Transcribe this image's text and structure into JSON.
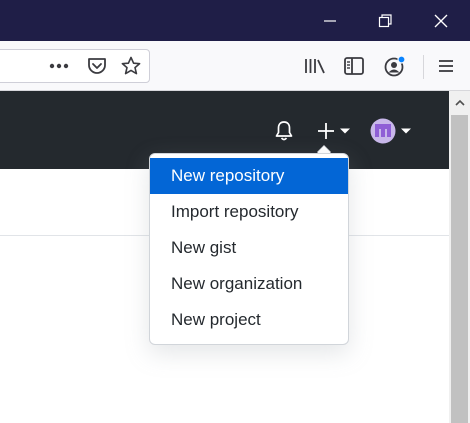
{
  "browser": {
    "window_controls": [
      "minimize",
      "restore",
      "close"
    ],
    "toolbar_icons": [
      "more-actions-icon",
      "pocket-icon",
      "bookmark-star-icon",
      "library-icon",
      "sidebar-icon",
      "account-icon",
      "menu-icon"
    ]
  },
  "header": {
    "icons": [
      "bell-icon",
      "plus-icon",
      "chevron-down-icon",
      "avatar",
      "chevron-down-icon"
    ]
  },
  "dropdown": {
    "items": [
      {
        "label": "New repository",
        "active": true
      },
      {
        "label": "Import repository"
      },
      {
        "label": "New gist"
      },
      {
        "label": "New organization"
      },
      {
        "label": "New project"
      }
    ]
  },
  "colors": {
    "titlebar": "#1f1e47",
    "header": "#24292e",
    "accent": "#0366d6"
  }
}
